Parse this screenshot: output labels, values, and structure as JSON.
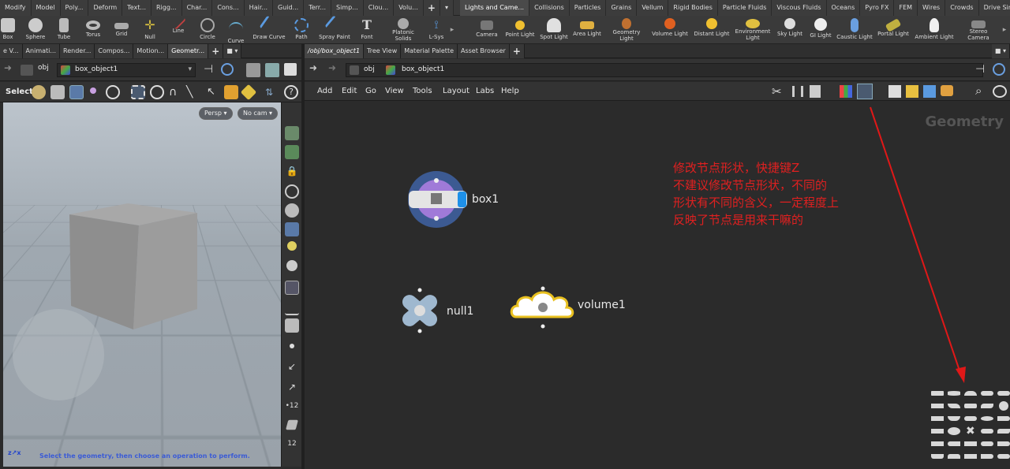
{
  "shelf": {
    "left_tabs": [
      "Modify",
      "Model",
      "Poly...",
      "Deform",
      "Text...",
      "Rigg...",
      "Char...",
      "Cons...",
      "Hair...",
      "Guid...",
      "Terr...",
      "Simp...",
      "Clou...",
      "Volu..."
    ],
    "right_tabs": [
      "Lights and Came...",
      "Collisions",
      "Particles",
      "Grains",
      "Vellum",
      "Rigid Bodies",
      "Particle Fluids",
      "Viscous Fluids",
      "Oceans",
      "Pyro FX",
      "FEM",
      "Wires",
      "Crowds",
      "Drive Simulation"
    ],
    "left_tools": [
      "Box",
      "Sphere",
      "Tube",
      "Torus",
      "Grid",
      "Null",
      "Line",
      "Circle",
      "Curve",
      "Draw Curve",
      "Path",
      "Spray Paint",
      "Font",
      "Platonic Solids",
      "L-Sys"
    ],
    "right_tools": [
      "Camera",
      "Point Light",
      "Spot Light",
      "Area Light",
      "Geometry Light",
      "Volume Light",
      "Distant Light",
      "Environment Light",
      "Sky Light",
      "GI Light",
      "Caustic Light",
      "Portal Light",
      "Ambient Light",
      "Stereo Camera"
    ]
  },
  "left_pane": {
    "tabs": [
      "e V...",
      "Animati...",
      "Render...",
      "Compos...",
      "Motion...",
      "Geometr..."
    ],
    "crumb_root": "obj",
    "crumb_node": "box_object1",
    "select_label": "Select",
    "persp_label": "Persp",
    "cam_label": "No cam",
    "status_text": "Select the geometry, then choose an operation to perform."
  },
  "right_pane": {
    "tabs": [
      "/obj/box_object1",
      "Tree View",
      "Material Palette",
      "Asset Browser"
    ],
    "crumb_root": "obj",
    "crumb_node": "box_object1",
    "menus": [
      "Add",
      "Edit",
      "Go",
      "View",
      "Tools",
      "Layout",
      "Labs",
      "Help"
    ],
    "context_label": "Geometry",
    "nodes": {
      "box": "box1",
      "null": "null1",
      "volume": "volume1"
    },
    "annotation": {
      "line1": "修改节点形状，快捷键Z",
      "line2": "不建议修改节点形状，不同的",
      "line3": "形状有不同的含义，一定程度上",
      "line4": "反映了节点是用来干嘛的"
    }
  },
  "colors": {
    "accent_blue": "#4f7bc0",
    "annotation_red": "#e02020",
    "status_blue": "#3b5bd6",
    "node_purple": "#a07ad8"
  }
}
